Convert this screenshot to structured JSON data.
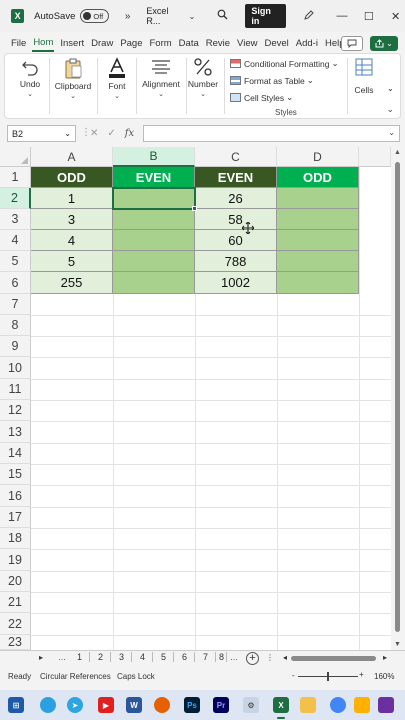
{
  "titlebar": {
    "app_icon": "excel-logo",
    "autosave_label": "AutoSave",
    "autosave_state": "Off",
    "overflow_glyph": "»",
    "doc_title": "Excel R...",
    "sign_in": "Sign in"
  },
  "tabs": [
    "File",
    "Hom",
    "Insert",
    "Draw",
    "Page",
    "Form",
    "Data",
    "Revie",
    "View",
    "Devel",
    "Add-i",
    "Help"
  ],
  "active_tab": "Hom",
  "ribbon": {
    "undo": "Undo",
    "clipboard": "Clipboard",
    "font": "Font",
    "alignment": "Alignment",
    "number": "Number",
    "conditional_formatting": "Conditional Formatting",
    "format_as_table": "Format as Table",
    "cell_styles": "Cell Styles",
    "styles_group": "Styles",
    "cells": "Cells"
  },
  "formula_bar": {
    "name_box": "B2",
    "fx": "fx",
    "value": ""
  },
  "grid": {
    "columns": [
      "A",
      "B",
      "C",
      "D"
    ],
    "rows": [
      "1",
      "2",
      "3",
      "4",
      "5",
      "6",
      "7",
      "8",
      "9",
      "10",
      "11",
      "12",
      "13",
      "14",
      "15",
      "16",
      "17",
      "18",
      "19",
      "20",
      "21",
      "22",
      "23"
    ],
    "selected_column": "B",
    "selected_row": "2",
    "headers": [
      "ODD",
      "EVEN",
      "EVEN",
      "ODD"
    ],
    "colA": [
      "1",
      "3",
      "4",
      "5",
      "255"
    ],
    "colB": [
      "",
      "",
      "",
      "",
      ""
    ],
    "colC": [
      "26",
      "58",
      "60",
      "788",
      "1002"
    ],
    "colD": [
      "",
      "",
      "",
      "",
      ""
    ]
  },
  "sheets": [
    "1",
    "2",
    "3",
    "4",
    "5",
    "6",
    "7",
    "8"
  ],
  "status": {
    "ready": "Ready",
    "circular": "Circular References",
    "caps": "Caps Lock",
    "zoom_minus": "-",
    "zoom_plus": "+",
    "zoom": "160%"
  },
  "colors": {
    "header_dark": "#385723",
    "header_green": "#00b050",
    "fill_light": "#e2efda",
    "fill_mid": "#a9d18e",
    "excel_green": "#1d6f42"
  }
}
